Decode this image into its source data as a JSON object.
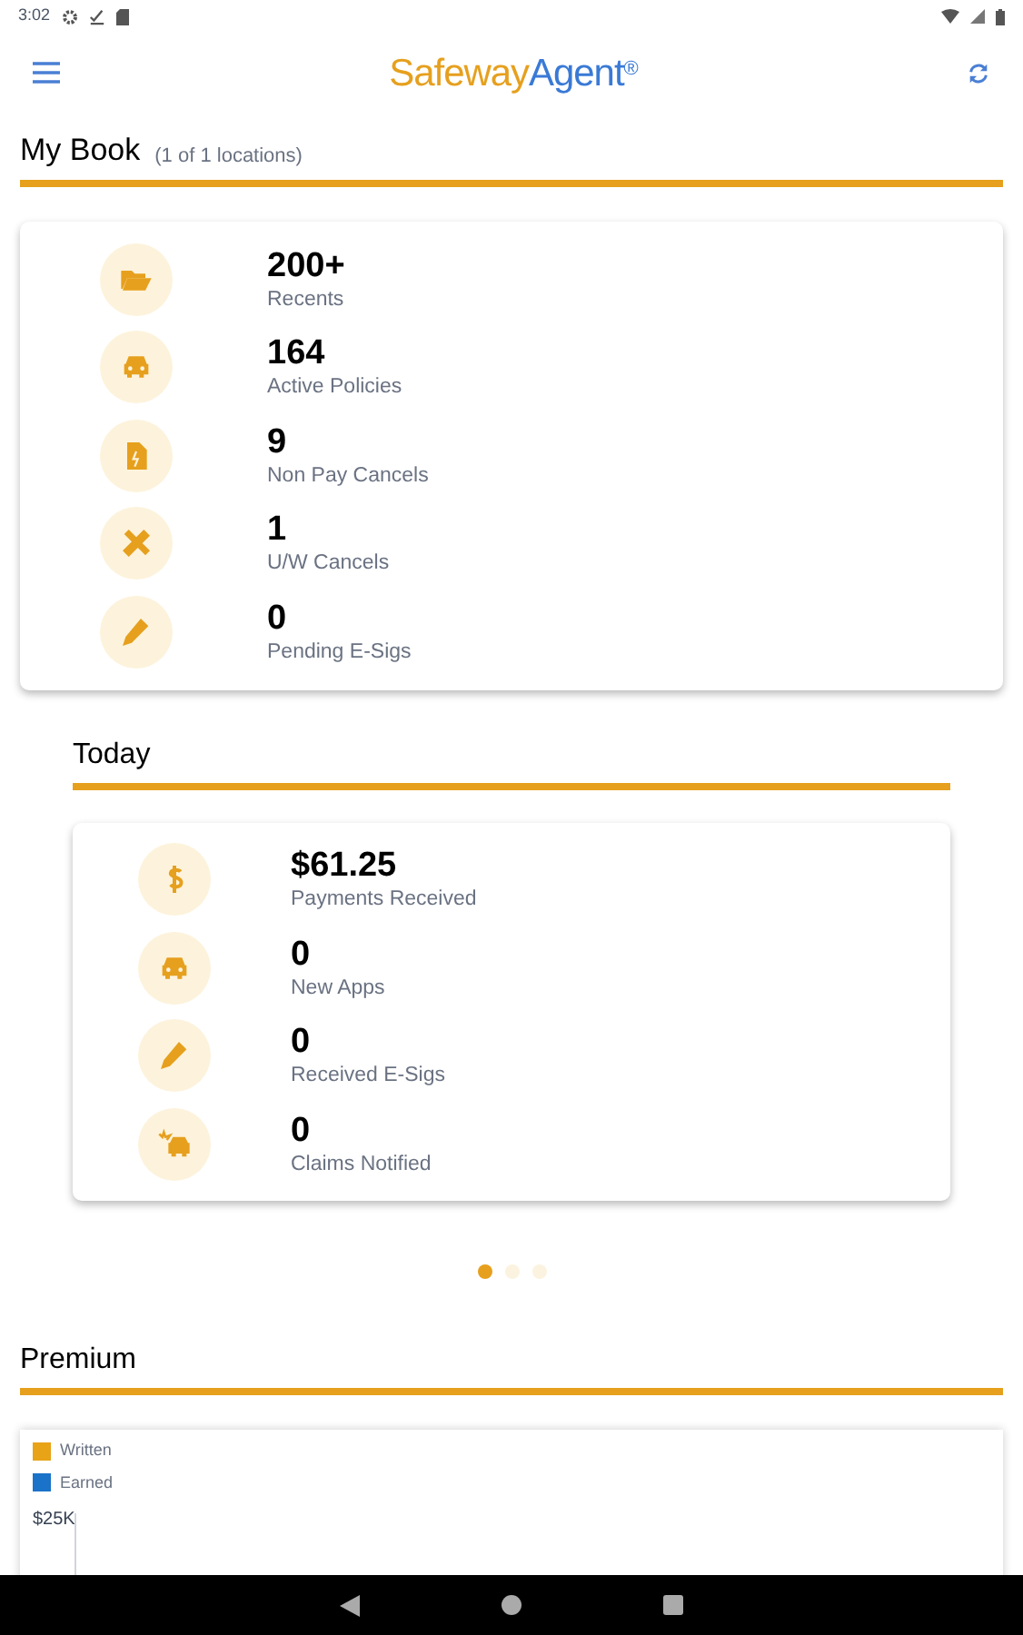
{
  "status_bar": {
    "time": "3:02"
  },
  "app_bar": {
    "logo": {
      "first": "Safeway",
      "second": "Agent",
      "mark": "®"
    }
  },
  "my_book": {
    "title": "My Book",
    "subtitle": "(1 of 1 locations)",
    "stats": [
      {
        "value": "200+",
        "label": "Recents"
      },
      {
        "value": "164",
        "label": "Active Policies"
      },
      {
        "value": "9",
        "label": "Non Pay Cancels"
      },
      {
        "value": "1",
        "label": "U/W Cancels"
      },
      {
        "value": "0",
        "label": "Pending E-Sigs"
      }
    ]
  },
  "today": {
    "title": "Today",
    "stats": [
      {
        "value": "$61.25",
        "label": "Payments Received"
      },
      {
        "value": "0",
        "label": "New Apps"
      },
      {
        "value": "0",
        "label": "Received E-Sigs"
      },
      {
        "value": "0",
        "label": "Claims Notified"
      }
    ]
  },
  "pager_dots": [
    {
      "selected": true
    },
    {
      "selected": false
    },
    {
      "selected": false
    }
  ],
  "premium": {
    "title": "Premium",
    "legend": [
      {
        "label": "Written",
        "color": "#e8a317"
      },
      {
        "label": "Earned",
        "color": "#1a73c8"
      }
    ],
    "y_tick": "$25K"
  }
}
